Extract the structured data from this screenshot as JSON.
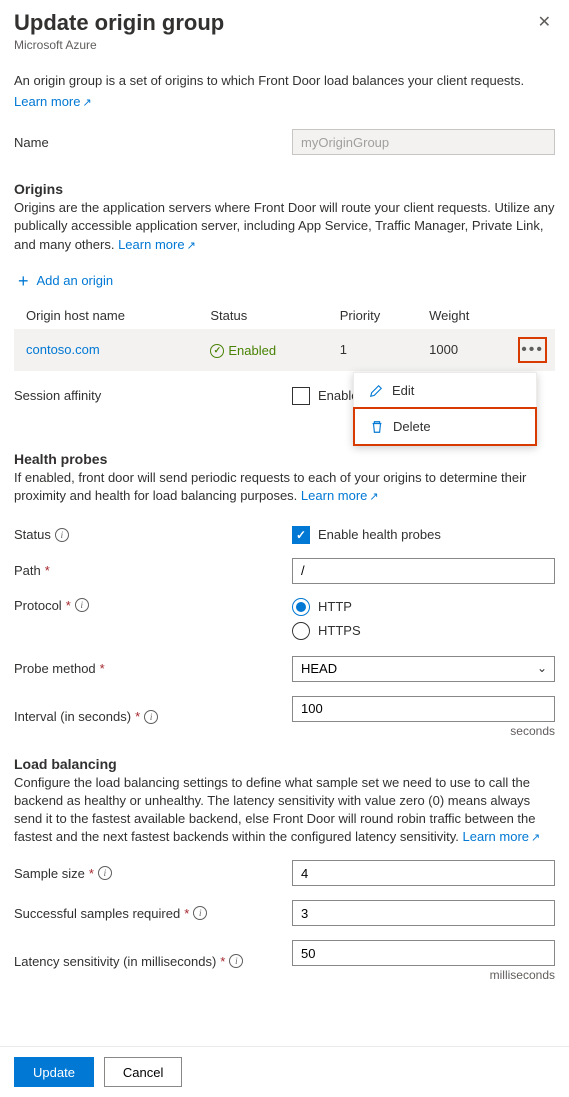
{
  "header": {
    "title": "Update origin group",
    "subtitle": "Microsoft Azure"
  },
  "intro": {
    "text": "An origin group is a set of origins to which Front Door load balances your client requests.",
    "learn_more": "Learn more"
  },
  "name_field": {
    "label": "Name",
    "value": "myOriginGroup"
  },
  "origins": {
    "heading": "Origins",
    "desc": "Origins are the application servers where Front Door will route your client requests. Utilize any publically accessible application server, including App Service, Traffic Manager, Private Link, and many others.",
    "learn_more": "Learn more",
    "add_label": "Add an origin",
    "columns": {
      "host": "Origin host name",
      "status": "Status",
      "priority": "Priority",
      "weight": "Weight"
    },
    "rows": [
      {
        "host": "contoso.com",
        "status": "Enabled",
        "priority": "1",
        "weight": "1000"
      }
    ],
    "menu": {
      "edit": "Edit",
      "delete": "Delete"
    }
  },
  "session_affinity": {
    "label": "Session affinity",
    "checkbox_partial": "Enable se"
  },
  "health": {
    "heading": "Health probes",
    "desc": "If enabled, front door will send periodic requests to each of your origins to determine their proximity and health for load balancing purposes.",
    "learn_more": "Learn more",
    "status_label": "Status",
    "status_checkbox": "Enable health probes",
    "path_label": "Path",
    "path_value": "/",
    "protocol_label": "Protocol",
    "protocol_http": "HTTP",
    "protocol_https": "HTTPS",
    "probe_method_label": "Probe method",
    "probe_method_value": "HEAD",
    "interval_label": "Interval (in seconds)",
    "interval_value": "100",
    "interval_unit": "seconds"
  },
  "lb": {
    "heading": "Load balancing",
    "desc": "Configure the load balancing settings to define what sample set we need to use to call the backend as healthy or unhealthy. The latency sensitivity with value zero (0) means always send it to the fastest available backend, else Front Door will round robin traffic between the fastest and the next fastest backends within the configured latency sensitivity.",
    "learn_more": "Learn more",
    "sample_label": "Sample size",
    "sample_value": "4",
    "success_label": "Successful samples required",
    "success_value": "3",
    "latency_label": "Latency sensitivity (in milliseconds)",
    "latency_value": "50",
    "latency_unit": "milliseconds"
  },
  "footer": {
    "update": "Update",
    "cancel": "Cancel"
  }
}
